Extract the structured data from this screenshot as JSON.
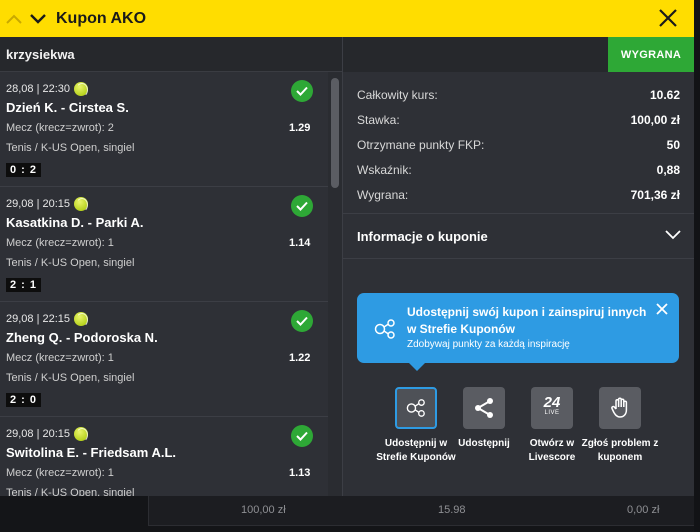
{
  "header": {
    "title": "Kupon AKO"
  },
  "user": {
    "name": "krzysiekwa"
  },
  "status": {
    "badge": "WYGRANA"
  },
  "bets": [
    {
      "datetime": "28,08 | 22:30",
      "match": "Dzień K. - Cirstea S.",
      "market": "Mecz (krecz=zwrot): 2",
      "odds": "1.29",
      "league": "Tenis / K-US Open, singiel",
      "score": "0 : 2"
    },
    {
      "datetime": "29,08 | 20:15",
      "match": "Kasatkina D. - Parki A.",
      "market": "Mecz (krecz=zwrot): 1",
      "odds": "1.14",
      "league": "Tenis / K-US Open, singiel",
      "score": "2 : 1"
    },
    {
      "datetime": "29,08 | 22:15",
      "match": "Zheng Q. - Podoroska N.",
      "market": "Mecz (krecz=zwrot): 1",
      "odds": "1.22",
      "league": "Tenis / K-US Open, singiel",
      "score": "2 : 0"
    },
    {
      "datetime": "29,08 | 20:15",
      "match": "Switolina E. - Friedsam A.L.",
      "market": "Mecz (krecz=zwrot): 1",
      "odds": "1.13",
      "league": "Tenis / K-US Open, singiel",
      "score": ""
    }
  ],
  "summary": [
    {
      "label": "Całkowity kurs:",
      "value": "10.62"
    },
    {
      "label": "Stawka:",
      "value": "100,00 zł"
    },
    {
      "label": "Otrzymane punkty FKP:",
      "value": "50"
    },
    {
      "label": "Wskaźnik:",
      "value": "0,88"
    },
    {
      "label": "Wygrana:",
      "value": "701,36 zł"
    }
  ],
  "info": {
    "label": "Informacje o kuponie"
  },
  "tooltip": {
    "title": "Udostępnij swój kupon i zainspiruj innych w Strefie Kuponów",
    "subtitle": "Zdobywaj punkty za każdą inspirację"
  },
  "actions": [
    {
      "label": "Udostępnij w Strefie Kuponów",
      "icon": "share-network-icon"
    },
    {
      "label": "Udostępnij",
      "icon": "share-icon"
    },
    {
      "label": "Otwórz w Livescore",
      "icon": "livescore-24-icon",
      "icon_text": "24",
      "icon_sub": "LIVE"
    },
    {
      "label": "Zgłoś problem z kuponem",
      "icon": "hand-icon"
    }
  ],
  "bottom": {
    "stake": "100,00 zł",
    "odds": "15.98",
    "win": "0,00 zł"
  },
  "colors": {
    "accent_yellow": "#ffdd00",
    "win_green": "#2ea836",
    "info_blue": "#2e9be3"
  }
}
